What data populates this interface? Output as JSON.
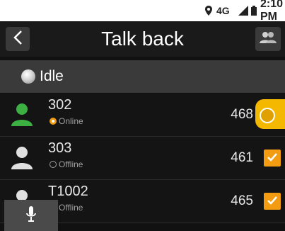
{
  "status_bar": {
    "network": "4G",
    "network_sub": "4G",
    "time": "2:10 PM",
    "icons": [
      "location-icon",
      "signal-icon",
      "battery-icon"
    ]
  },
  "header": {
    "title": "Talk back",
    "back_icon": "chevron-left-icon",
    "contacts_icon": "contacts-icon"
  },
  "idle_bar": {
    "label": "Idle"
  },
  "contacts": [
    {
      "name": "302",
      "status": "Online",
      "number": "468",
      "avatar_color": "#3cb043",
      "selected": false,
      "speaking": true
    },
    {
      "name": "303",
      "status": "Offline",
      "number": "461",
      "avatar_color": "#e0e0e0",
      "selected": true,
      "speaking": false
    },
    {
      "name": "T1002",
      "status": "Offline",
      "number": "465",
      "avatar_color": "#e0e0e0",
      "selected": true,
      "speaking": false
    }
  ],
  "ptt": {
    "icon": "microphone-icon"
  },
  "colors": {
    "accent": "#f39c12",
    "speaking": "#f5b800",
    "online_avatar": "#3cb043"
  }
}
